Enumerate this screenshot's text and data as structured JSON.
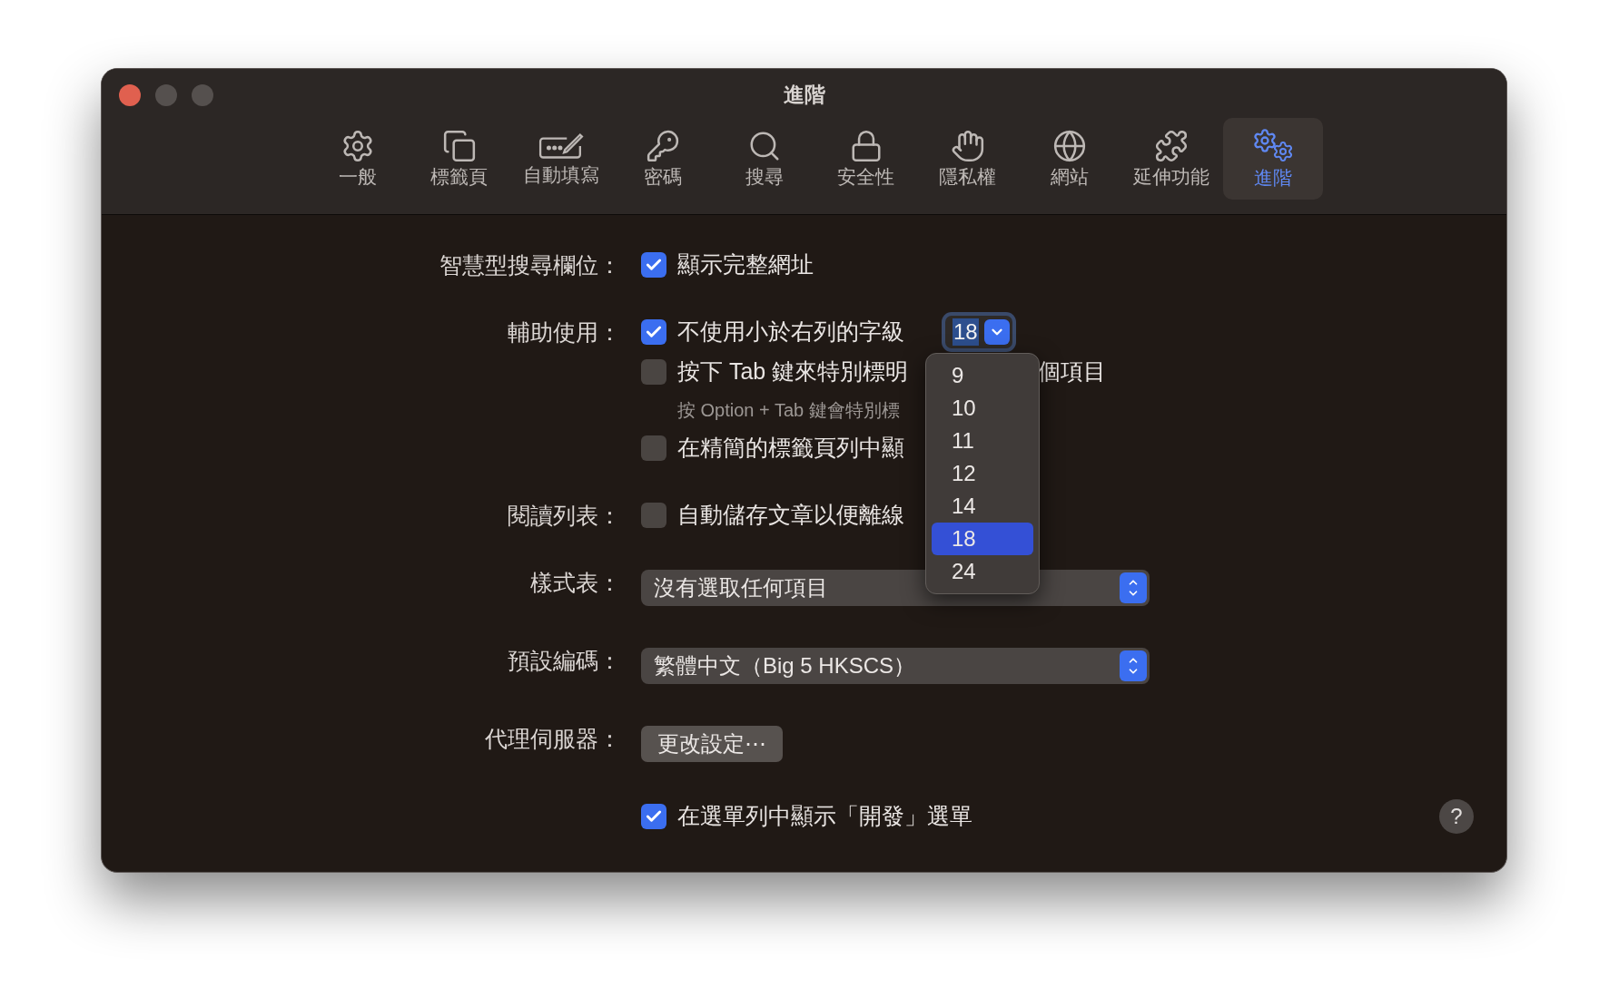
{
  "window": {
    "title": "進階"
  },
  "toolbar": [
    {
      "kind": "general",
      "label": "一般",
      "selected": false
    },
    {
      "kind": "tabs",
      "label": "標籤頁",
      "selected": false
    },
    {
      "kind": "autofill",
      "label": "自動填寫",
      "selected": false
    },
    {
      "kind": "passwords",
      "label": "密碼",
      "selected": false
    },
    {
      "kind": "search",
      "label": "搜尋",
      "selected": false
    },
    {
      "kind": "security",
      "label": "安全性",
      "selected": false
    },
    {
      "kind": "privacy",
      "label": "隱私權",
      "selected": false
    },
    {
      "kind": "websites",
      "label": "網站",
      "selected": false
    },
    {
      "kind": "extensions",
      "label": "延伸功能",
      "selected": false
    },
    {
      "kind": "advanced",
      "label": "進階",
      "selected": true
    }
  ],
  "settings": [
    {
      "label": "智慧型搜尋欄位：",
      "controls": [
        {
          "kind": "checkbox",
          "text": "顯示完整網址",
          "checked": true
        }
      ]
    },
    {
      "label": "輔助使用：",
      "controls": [
        {
          "kind": "checkbox",
          "text": "不使用小於右列的字級",
          "checked": true,
          "font_size": {
            "value": "18",
            "expanded": true,
            "options": [
              {
                "label": "9",
                "selected": false
              },
              {
                "label": "10",
                "selected": false
              },
              {
                "label": "11",
                "selected": false
              },
              {
                "label": "12",
                "selected": false
              },
              {
                "label": "14",
                "selected": false
              },
              {
                "label": "18",
                "selected": true
              },
              {
                "label": "24",
                "selected": false
              }
            ]
          }
        },
        {
          "kind": "checkbox",
          "text": "按下 Tab 鍵來特別標明",
          "text_after": "個項目",
          "checked": false
        },
        {
          "kind": "hint",
          "text": "按 Option + Tab 鍵會特別標"
        },
        {
          "kind": "checkbox",
          "text": "在精簡的標籤頁列中顯",
          "checked": false
        }
      ]
    },
    {
      "label": "閱讀列表：",
      "controls": [
        {
          "kind": "checkbox",
          "text": "自動儲存文章以便離線",
          "checked": false
        }
      ]
    },
    {
      "label": "樣式表：",
      "controls": [
        {
          "kind": "select",
          "value": "沒有選取任何項目"
        }
      ]
    },
    {
      "label": "預設編碼：",
      "controls": [
        {
          "kind": "select",
          "value": "繁體中文（Big 5 HKSCS）"
        }
      ]
    },
    {
      "label": "代理伺服器：",
      "controls": [
        {
          "kind": "button",
          "text": "更改設定⋯"
        }
      ]
    },
    {
      "controls": [
        {
          "kind": "checkbox",
          "text": "在選單列中顯示「開發」選單",
          "checked": true
        }
      ]
    }
  ],
  "help": {
    "text": "?"
  }
}
